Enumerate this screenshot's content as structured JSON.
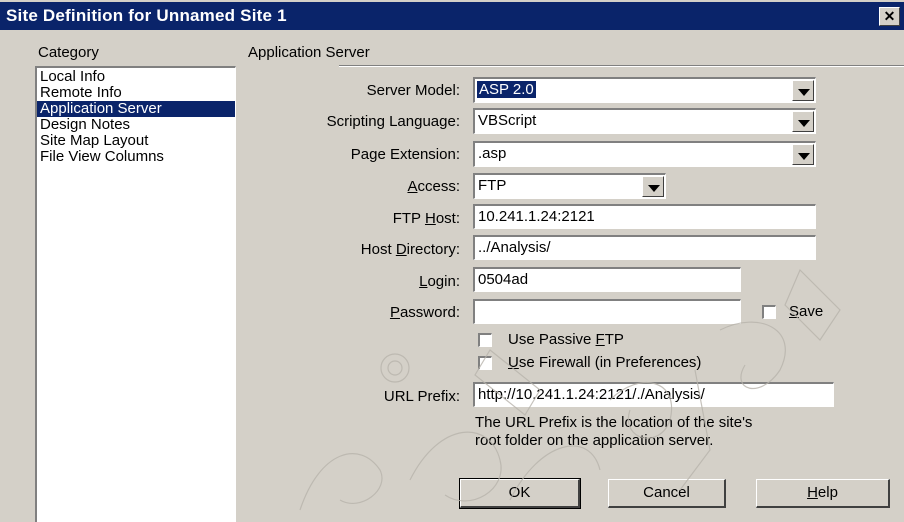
{
  "window": {
    "title": "Site Definition for Unnamed Site 1",
    "close_glyph": "✕"
  },
  "category": {
    "header": "Category",
    "items": [
      {
        "label": "Local Info"
      },
      {
        "label": "Remote Info"
      },
      {
        "label": "Application Server",
        "selected": true
      },
      {
        "label": "Design Notes"
      },
      {
        "label": "Site Map Layout"
      },
      {
        "label": "File View Columns"
      }
    ]
  },
  "section": {
    "title": "Application Server"
  },
  "form": {
    "server_model": {
      "label": "Server Model:",
      "value": "ASP 2.0"
    },
    "scripting_language": {
      "label": "Scripting Language:",
      "value": "VBScript"
    },
    "page_extension": {
      "label": "Page Extension:",
      "value": ".asp"
    },
    "access": {
      "label_pre": "",
      "label_u": "A",
      "label_post": "ccess:",
      "value": "FTP"
    },
    "ftp_host": {
      "label_pre": "FTP ",
      "label_u": "H",
      "label_post": "ost:",
      "value": "10.241.1.24:2121"
    },
    "host_directory": {
      "label_pre": "Host ",
      "label_u": "D",
      "label_post": "irectory:",
      "value": "../Analysis/"
    },
    "login": {
      "label_pre": "",
      "label_u": "L",
      "label_post": "ogin:",
      "value": "0504ad"
    },
    "password": {
      "label_pre": "",
      "label_u": "P",
      "label_post": "assword:",
      "value": ""
    },
    "save": {
      "label_pre": "",
      "label_u": "S",
      "label_post": "ave",
      "checked": false
    },
    "passive_ftp": {
      "label_pre": "Use Passive ",
      "label_u": "F",
      "label_post": "TP",
      "checked": false
    },
    "firewall": {
      "label_pre": "",
      "label_u": "U",
      "label_post": "se Firewall (in Preferences)",
      "checked": false
    },
    "url_prefix": {
      "label": "URL Prefix:",
      "value": "http://10.241.1.24:2121/./Analysis/"
    },
    "url_help_line1": "The URL Prefix is the location of the site's",
    "url_help_line2": "root folder on the application server."
  },
  "buttons": {
    "ok": "OK",
    "cancel": "Cancel",
    "help_u": "H",
    "help_post": "elp"
  }
}
